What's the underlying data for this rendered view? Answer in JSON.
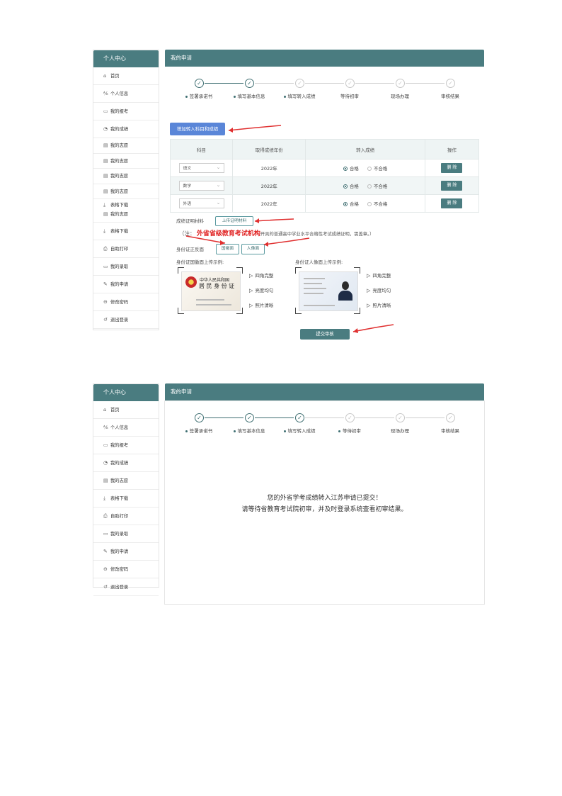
{
  "sidebar_title": "个人中心",
  "sidebar1": [
    {
      "icon": "home-icon",
      "glyph": "⌂",
      "label": "首页"
    },
    {
      "icon": "user-icon",
      "glyph": "⅍",
      "label": "个人信息"
    },
    {
      "icon": "card-icon",
      "glyph": "▭",
      "label": "我的报考"
    },
    {
      "icon": "chart-icon",
      "glyph": "◔",
      "label": "我的成绩"
    },
    {
      "icon": "doc-icon",
      "glyph": "▤",
      "label": "我的志愿"
    },
    {
      "icon": "doc-icon",
      "glyph": "▤",
      "label": "我的志愿"
    },
    {
      "icon": "doc-icon",
      "glyph": "▤",
      "label": "我的志愿"
    },
    {
      "icon": "doc-icon",
      "glyph": "▤",
      "label": "我的志愿"
    }
  ],
  "sidebar1_combo": {
    "a": "表格下载",
    "b": "我的志愿"
  },
  "sidebar1_tail": [
    {
      "icon": "download-icon",
      "glyph": "⤓",
      "label": "表格下载"
    },
    {
      "icon": "printer-icon",
      "glyph": "⎙",
      "label": "自助打印"
    },
    {
      "icon": "calendar-icon",
      "glyph": "▭",
      "label": "我的录取"
    },
    {
      "icon": "edit-icon",
      "glyph": "✎",
      "label": "我的申请"
    },
    {
      "icon": "lock-icon",
      "glyph": "⊖",
      "label": "修改密码"
    },
    {
      "icon": "logout-icon",
      "glyph": "↺",
      "label": "退出登录"
    }
  ],
  "sidebar2": [
    {
      "icon": "home-icon",
      "glyph": "⌂",
      "label": "首页"
    },
    {
      "icon": "user-icon",
      "glyph": "⅍",
      "label": "个人信息"
    },
    {
      "icon": "card-icon",
      "glyph": "▭",
      "label": "我的报考"
    },
    {
      "icon": "chart-icon",
      "glyph": "◔",
      "label": "我的成绩"
    },
    {
      "icon": "doc-icon",
      "glyph": "▤",
      "label": "我的志愿"
    },
    {
      "icon": "download-icon",
      "glyph": "⤓",
      "label": "表格下载"
    },
    {
      "icon": "printer-icon",
      "glyph": "⎙",
      "label": "自助打印"
    },
    {
      "icon": "calendar-icon",
      "glyph": "▭",
      "label": "我的录取"
    },
    {
      "icon": "edit-icon",
      "glyph": "✎",
      "label": "我的申请"
    },
    {
      "icon": "lock-icon",
      "glyph": "⊖",
      "label": "修改密码"
    },
    {
      "icon": "logout-icon",
      "glyph": "↺",
      "label": "退出登录"
    }
  ],
  "main_title": "我的申请",
  "check_glyph": "✓",
  "steps": [
    "签署承诺书",
    "填写基本信息",
    "填写转入成绩",
    "等待初审",
    "现场办理",
    "审核结果"
  ],
  "add_button": "增加转入科目和成绩",
  "table": {
    "headers": [
      "科目",
      "取得成绩年份",
      "转入成绩",
      "操作"
    ],
    "rows": [
      {
        "subject": "语文",
        "year": "2022年",
        "pass": "合格",
        "fail": "不合格",
        "action": "删 除"
      },
      {
        "subject": "数学",
        "year": "2022年",
        "pass": "合格",
        "fail": "不合格",
        "action": "删 除"
      },
      {
        "subject": "外语",
        "year": "2022年",
        "pass": "合格",
        "fail": "不合格",
        "action": "删 除"
      }
    ]
  },
  "materials_label": "成绩证明材料",
  "upload_button": "上传证明材料",
  "note_prefix": "（注：",
  "note_bold": "外省省级教育考试机构",
  "note_suffix": "开具的普通高中学业水平合格性考试成绩证明，需盖章。）",
  "id_label": "身份证正反面",
  "emblem_button": "国徽面",
  "portrait_button": "人像面",
  "emblem_example": "身份证国徽面上传示例:",
  "portrait_example": "身份证人像面上传示例:",
  "card_front": {
    "line1": "中华人民共和国",
    "line2": "居 民 身 份 证"
  },
  "features": [
    "四角完整",
    "亮度均匀",
    "照片清晰"
  ],
  "submit_button": "提交审核",
  "done_message": {
    "line1": "您的外省学考成绩转入江苏申请已提交！",
    "line2": "请等待省教育考试院初审，并及时登录系统查看初审结果。"
  },
  "colors": {
    "primary": "#4a7c80",
    "accent": "#5a86d8",
    "arrow": "#e03030",
    "note": "#e02020"
  }
}
